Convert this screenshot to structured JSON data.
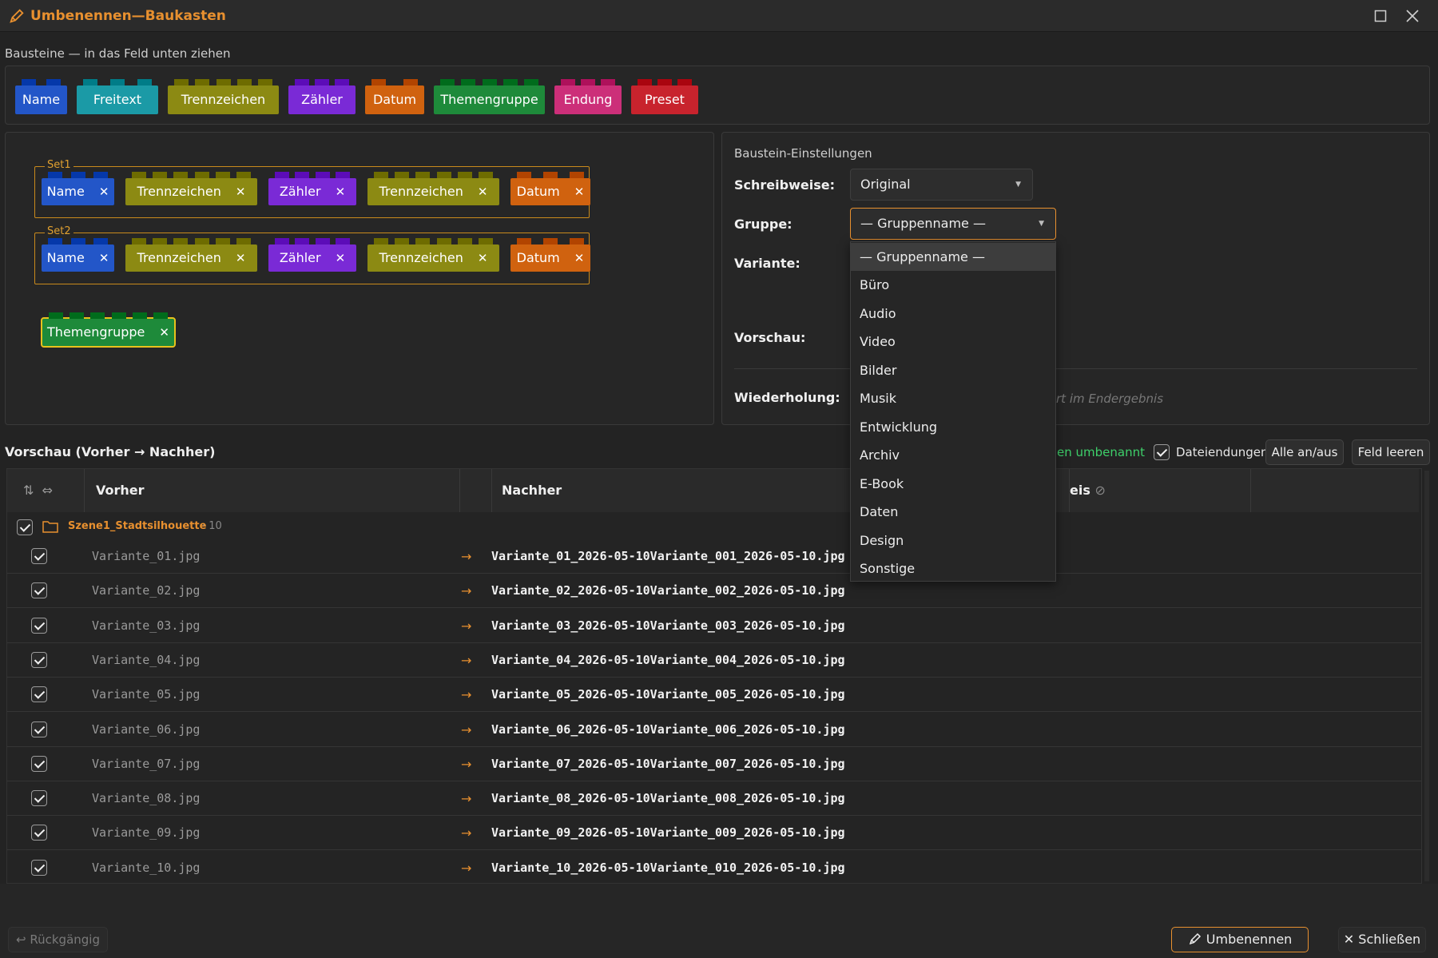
{
  "window": {
    "title": "Umbenennen—Baukasten",
    "maximize_icon": "square-icon",
    "close_icon": "close-icon"
  },
  "palette": {
    "label": "Bausteine — in das Feld unten ziehen",
    "bricks": [
      {
        "label": "Name",
        "color": "#2356c8"
      },
      {
        "label": "Freitext",
        "color": "#1b9aa6"
      },
      {
        "label": "Trennzeichen",
        "color": "#8c8a13"
      },
      {
        "label": "Zähler",
        "color": "#7a2ad6"
      },
      {
        "label": "Datum",
        "color": "#d0620f"
      },
      {
        "label": "Themengruppe",
        "color": "#1e8a3a"
      },
      {
        "label": "Endung",
        "color": "#cc2f79"
      },
      {
        "label": "Preset",
        "color": "#c8232d"
      }
    ]
  },
  "canvas": {
    "sets": [
      {
        "label": "Set1",
        "bricks": [
          "Name",
          "Trennzeichen",
          "Zähler",
          "Trennzeichen",
          "Datum"
        ]
      },
      {
        "label": "Set2",
        "bricks": [
          "Name",
          "Trennzeichen",
          "Zähler",
          "Trennzeichen",
          "Datum"
        ]
      }
    ],
    "loose_brick": "Themengruppe",
    "remove_glyph": "✕"
  },
  "settings": {
    "title": "Baustein-Einstellungen",
    "schreibweise_label": "Schreibweise:",
    "schreibweise_value": "Original",
    "gruppe_label": "Gruppe:",
    "gruppe_value": "— Gruppenname —",
    "variante_label": "Variante:",
    "vorschau_label": "Vorschau:",
    "wiederholung_label": "Wiederholung:",
    "wiederholung_hint_partial": "rt im Endergebnis"
  },
  "dropdown": {
    "options": [
      "— Gruppenname —",
      "Büro",
      "Audio",
      "Video",
      "Bilder",
      "Musik",
      "Entwicklung",
      "Archiv",
      "E-Book",
      "Daten",
      "Design",
      "Sonstige"
    ],
    "selected_index": 0
  },
  "preview": {
    "title": "Vorschau (Vorher → Nachher)",
    "status_partial": "en umbenannt",
    "dateiendungen_label": "Dateiendungen",
    "dateiendungen_checked": true,
    "toggle_all_label": "Alle an/aus",
    "clear_label": "Feld leeren",
    "columns": {
      "before": "Vorher",
      "after": "Nachher",
      "hint_partial": "eis"
    },
    "group": {
      "name": "Szene1_Stadtsilhouette",
      "count": "· 10"
    },
    "rows": [
      {
        "before": "Variante_01.jpg",
        "after": "Variante_01_2026-05-10Variante_001_2026-05-10.jpg"
      },
      {
        "before": "Variante_02.jpg",
        "after": "Variante_02_2026-05-10Variante_002_2026-05-10.jpg"
      },
      {
        "before": "Variante_03.jpg",
        "after": "Variante_03_2026-05-10Variante_003_2026-05-10.jpg"
      },
      {
        "before": "Variante_04.jpg",
        "after": "Variante_04_2026-05-10Variante_004_2026-05-10.jpg"
      },
      {
        "before": "Variante_05.jpg",
        "after": "Variante_05_2026-05-10Variante_005_2026-05-10.jpg"
      },
      {
        "before": "Variante_06.jpg",
        "after": "Variante_06_2026-05-10Variante_006_2026-05-10.jpg"
      },
      {
        "before": "Variante_07.jpg",
        "after": "Variante_07_2026-05-10Variante_007_2026-05-10.jpg"
      },
      {
        "before": "Variante_08.jpg",
        "after": "Variante_08_2026-05-10Variante_008_2026-05-10.jpg"
      },
      {
        "before": "Variante_09.jpg",
        "after": "Variante_09_2026-05-10Variante_009_2026-05-10.jpg"
      },
      {
        "before": "Variante_10.jpg",
        "after": "Variante_10_2026-05-10Variante_010_2026-05-10.jpg"
      }
    ],
    "arrow": "→"
  },
  "footer": {
    "undo_label": "↩ Rückgängig",
    "rename_label": "Umbenennen",
    "close_label": "✕ Schließen"
  },
  "colors": {
    "accent": "#e8902f",
    "success": "#3ecf6a"
  }
}
